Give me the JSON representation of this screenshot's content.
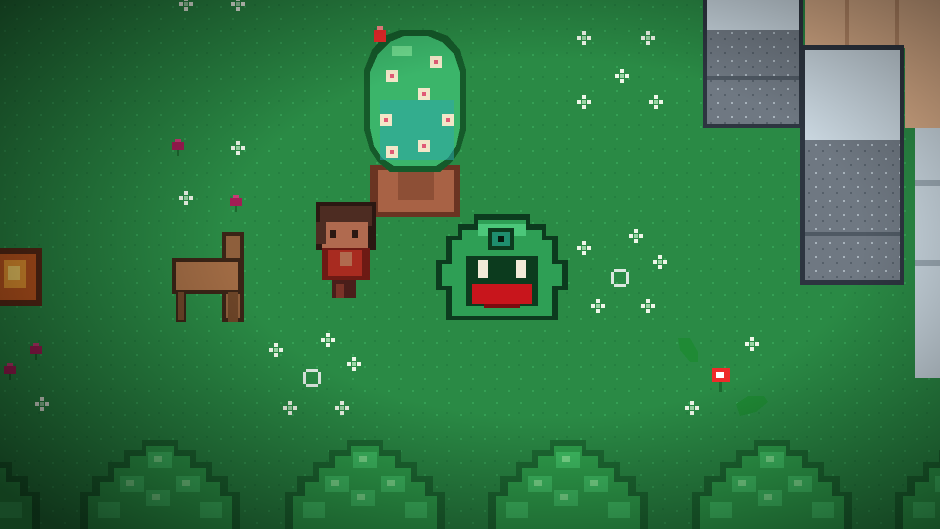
{
  "scene": {
    "colors": {
      "grass": "#2a8a45",
      "grass_dark": "#1c5a2e",
      "vignette": "#000000",
      "stone": "#6f7882",
      "stone_light": "#c8d5de",
      "dirt_path": "#d6aa86",
      "tree_canopy": "#3bb56a",
      "trunk": "#a86245",
      "slime": "#2e9f55",
      "slime_mouth": "#c8151c",
      "bush": "#2fa24d",
      "chair": "#8e5f3c",
      "hero_skin": "#b06a4f",
      "hero_hair": "#4d2c22",
      "hero_shirt": "#a82b20",
      "flower_white": "#eef6e8",
      "flower_red": "#ee2a2a",
      "flower_magenta": "#a21d55"
    },
    "objects": [
      "tree-icon",
      "player-character-icon",
      "green-slime-enemy-icon",
      "wooden-chair-icon",
      "stone-wall-icon",
      "campfire-icon",
      "bush-icon",
      "flower-icon",
      "ring-item-icon",
      "leaf-icon"
    ]
  }
}
